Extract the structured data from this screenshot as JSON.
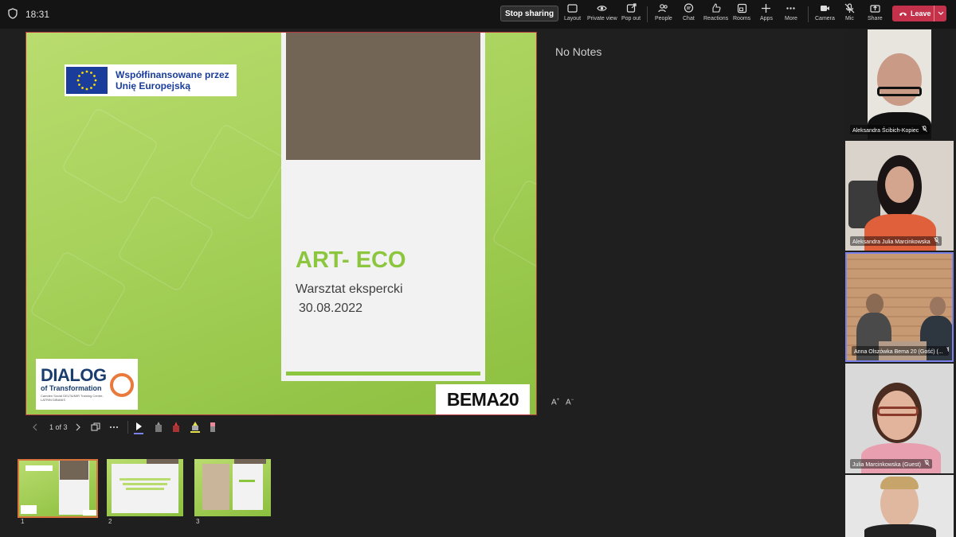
{
  "topbar": {
    "time": "18:31",
    "stop_sharing": "Stop sharing",
    "tools": [
      {
        "label": "Layout",
        "icon": "layout-icon"
      },
      {
        "label": "Private view",
        "icon": "eye-icon"
      },
      {
        "label": "Pop out",
        "icon": "pop-out-icon"
      },
      {
        "label": "People",
        "icon": "people-icon"
      },
      {
        "label": "Chat",
        "icon": "chat-icon"
      },
      {
        "label": "Reactions",
        "icon": "reactions-icon"
      },
      {
        "label": "Rooms",
        "icon": "rooms-icon"
      },
      {
        "label": "Apps",
        "icon": "plus-icon"
      },
      {
        "label": "More",
        "icon": "more-icon"
      },
      {
        "label": "Camera",
        "icon": "camera-icon"
      },
      {
        "label": "Mic",
        "icon": "mic-off-icon"
      },
      {
        "label": "Share",
        "icon": "share-icon"
      }
    ],
    "leave": "Leave"
  },
  "slide": {
    "eu_line1": "Współfinansowane przez",
    "eu_line2": "Unię Europejską",
    "title": "ART- ECO",
    "subtitle": "Warsztat ekspercki",
    "date": "30.08.2022",
    "dialog_word": "DIALOG",
    "dialog_of": "of Transformation",
    "dialog_small": "Camden Social DELTA/MIR Training Centre, LATRIN DIBANIS",
    "bema": "BEMA20"
  },
  "controls": {
    "page": "1 of 3"
  },
  "notes": "No Notes",
  "font_controls": {
    "increase": "A",
    "decrease": "A"
  },
  "thumbnails": [
    {
      "num": "1",
      "selected": true
    },
    {
      "num": "2",
      "selected": false
    },
    {
      "num": "3",
      "selected": false
    }
  ],
  "participants": [
    {
      "name": "Aleksandra Ścibich-Kopiec"
    },
    {
      "name": "Aleksandra Julia Marcinkowska"
    },
    {
      "name": "Anna Olszówka Bema 20 (Gość) (..."
    },
    {
      "name": "Julia Marcinkowska (Guest)"
    },
    {
      "name": ""
    }
  ],
  "colors": {
    "accent_green": "#8cc63f",
    "leave_red": "#c4314b",
    "active_tile": "#7b83eb",
    "selected_thumb": "#d8743c"
  }
}
